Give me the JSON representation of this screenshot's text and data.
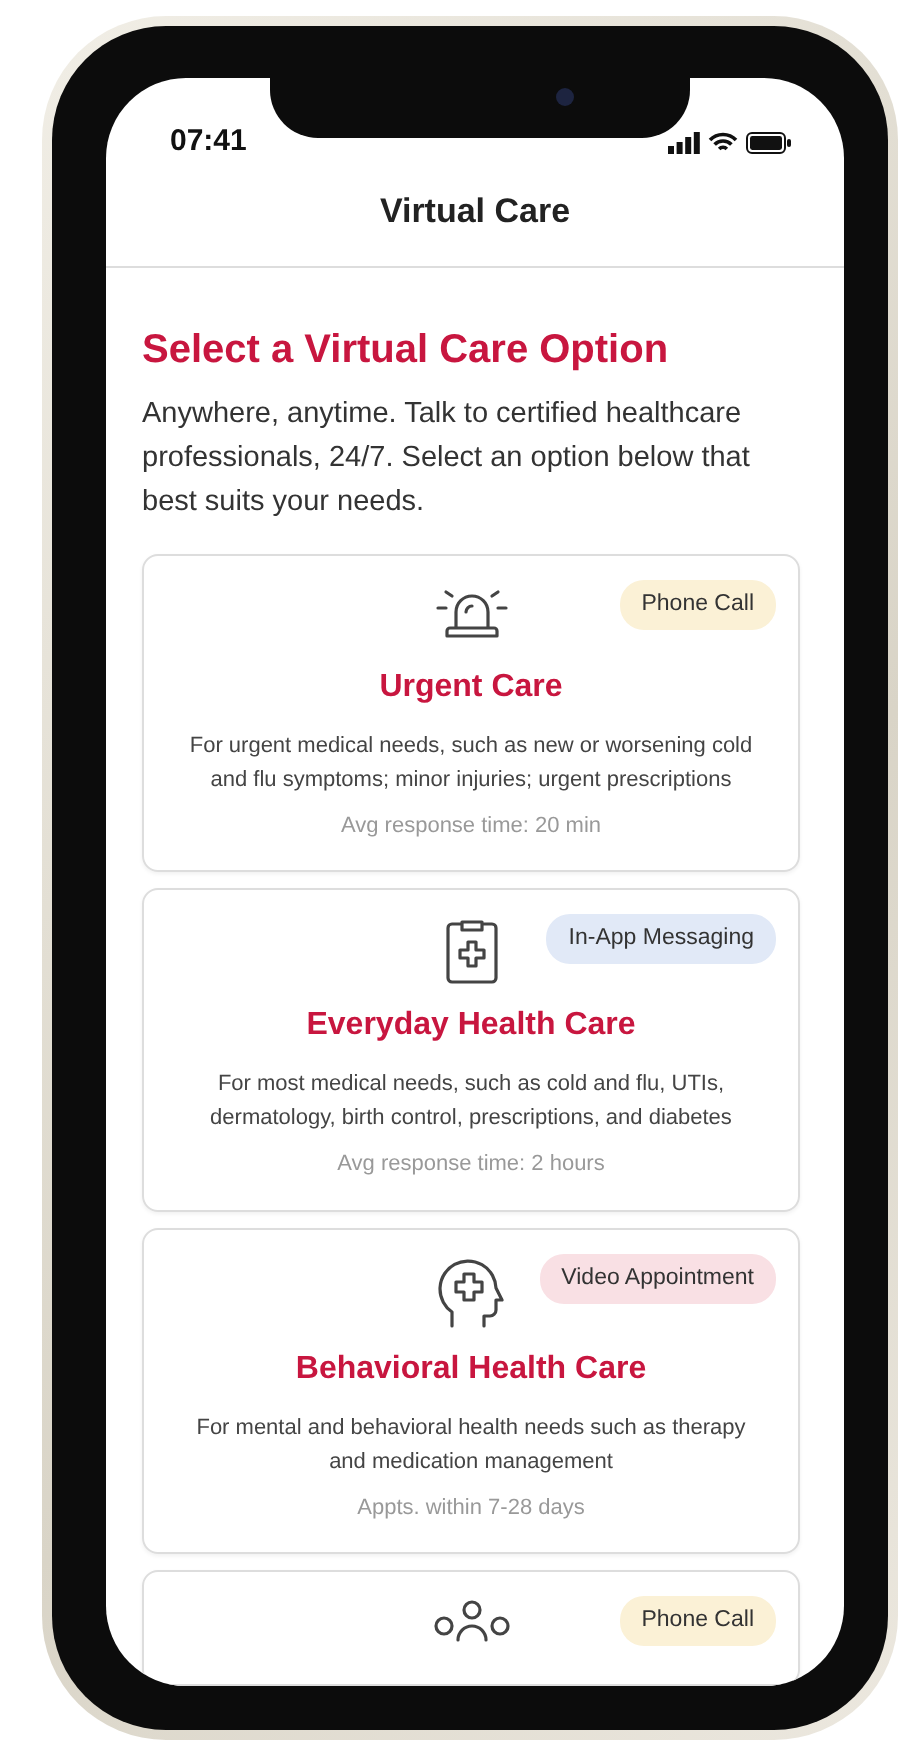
{
  "status_bar": {
    "time": "07:41"
  },
  "header": {
    "title": "Virtual Care"
  },
  "intro": {
    "heading": "Select a Virtual Care Option",
    "text": "Anywhere, anytime. Talk to certified healthcare professionals, 24/7. Select an option below that best suits your needs."
  },
  "options": [
    {
      "kind": "siren",
      "badge": {
        "kind": "phone",
        "label": "Phone Call"
      },
      "title": "Urgent Care",
      "description": "For urgent medical needs, such as new or worsening cold and flu symptoms; minor injuries; urgent prescriptions",
      "meta": "Avg response time: 20 min"
    },
    {
      "kind": "clipboard",
      "badge": {
        "kind": "messaging",
        "label": "In-App Messaging"
      },
      "title": "Everyday Health Care",
      "description": "For most medical needs, such as cold and flu, UTIs, dermatology, birth control, prescriptions, and diabetes",
      "meta": "Avg response time: 2 hours"
    },
    {
      "kind": "head",
      "badge": {
        "kind": "video",
        "label": "Video Appointment"
      },
      "title": "Behavioral Health Care",
      "description": "For mental and behavioral health needs such as therapy and medication management",
      "meta": "Appts. within 7-28 days"
    },
    {
      "kind": "people",
      "badge": {
        "kind": "phone",
        "label": "Phone Call"
      }
    }
  ]
}
